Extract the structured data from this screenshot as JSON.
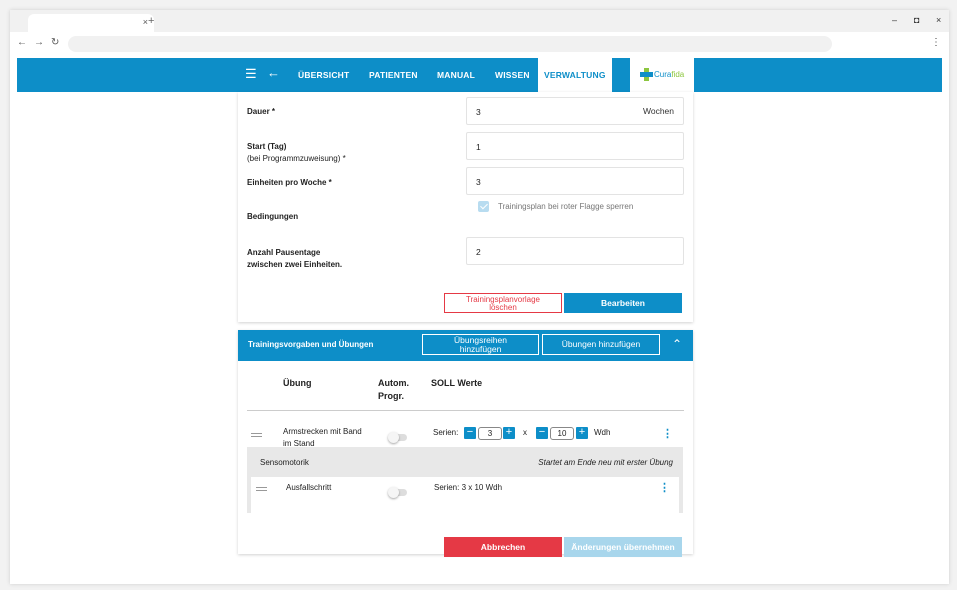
{
  "browser": {
    "tab_close": "×",
    "new_tab": "+",
    "back": "←",
    "forward": "→",
    "reload": "↻",
    "menu": "⋮",
    "minimize": "–",
    "maximize": "◘",
    "close": "×"
  },
  "nav": {
    "items": [
      "ÜBERSICHT",
      "PATIENTEN",
      "MANUAL",
      "WISSEN",
      "VERWALTUNG"
    ],
    "active": "VERWALTUNG",
    "logo": {
      "main": "Cura",
      "accent": "fida"
    }
  },
  "form": {
    "duration": {
      "label": "Dauer *",
      "value": "3",
      "unit": "Wochen"
    },
    "start": {
      "label1": "Start (Tag)",
      "label2": "(bei Programmzuweisung) *",
      "value": "1"
    },
    "units": {
      "label": "Einheiten pro Woche *",
      "value": "3"
    },
    "conditions": {
      "label": "Bedingungen",
      "checkbox_label": "Trainingsplan bei roter Flagge sperren",
      "checked": true
    },
    "pause": {
      "label1": "Anzahl Pausentage",
      "label2": "zwischen zwei Einheiten.",
      "value": "2"
    },
    "delete_line1": "Trainingsplanvorlage",
    "delete_line2": "löschen",
    "edit": "Bearbeiten"
  },
  "exercises": {
    "title": "Trainingsvorgaben und Übungen",
    "add_series_line1": "Übungsreihen",
    "add_series_line2": "hinzufügen",
    "add_exercises": "Übungen hinzufügen",
    "collapse": "⌃",
    "col_exercise": "Übung",
    "col_autom_line1": "Autom.",
    "col_autom_line2": "Progr.",
    "col_target": "SOLL Werte",
    "row1": {
      "name_line1": "Armstrecken mit Band",
      "name_line2": "im Stand",
      "series_label": "Serien:",
      "sets": "3",
      "times": "x",
      "reps": "10",
      "unit": "Wdh",
      "minus": "−",
      "plus": "+"
    },
    "group": {
      "name": "Sensomotorik",
      "note": "Startet am Ende neu mit erster Übung",
      "row": {
        "name": "Ausfallschritt",
        "values": "Serien: 3 x 10 Wdh"
      }
    },
    "menu_icon": "⋮",
    "cancel": "Abbrechen",
    "apply": "Änderungen übernehmen"
  }
}
